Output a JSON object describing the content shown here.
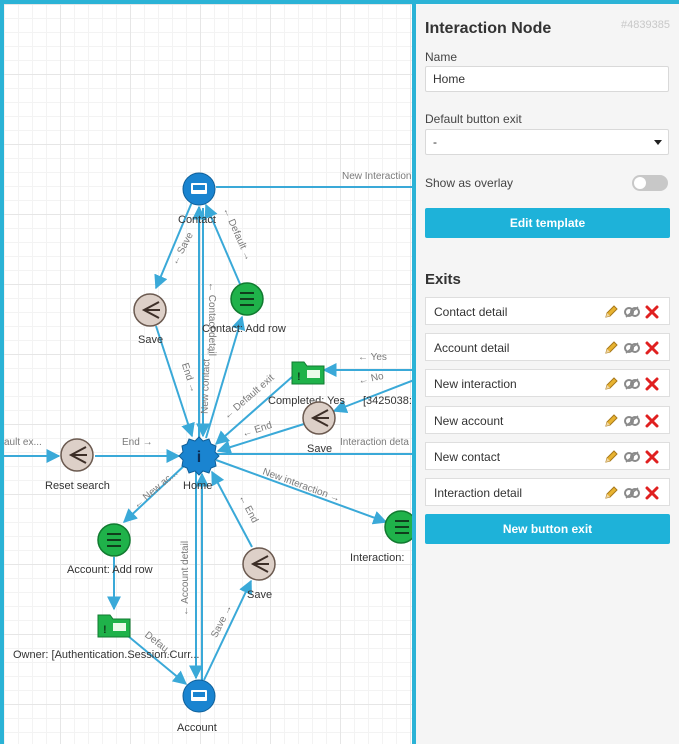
{
  "canvas": {
    "nodes": {
      "contact": "Contact",
      "save1": "Save",
      "contact_add_row": "Contact: Add row",
      "completed": "Completed: Yes",
      "id_partial": "[3425038:",
      "save2": "Save",
      "reset_search": "Reset search",
      "home": "Home",
      "interaction": "Interaction:",
      "account_add_row": "Account: Add row",
      "owner": "Owner: [Authentication.Session.Curr...",
      "save3": "Save",
      "account": "Account"
    },
    "edges": {
      "new_interaction_top": "New Interaction",
      "save": "← Save",
      "default_top": "← Default →",
      "contact_detail": "← Contact detail",
      "new_contact": "New contact →",
      "end_save1": "End →",
      "default_exit": "← Default exit",
      "yes": "← Yes",
      "no": "← No",
      "end_save2": "← End",
      "interaction_detail": "Interaction deta",
      "default_exit_left": "ault ex...",
      "end_reset": "End →",
      "new_account": "← New ac...",
      "new_interaction": "New interaction →",
      "account_detail": "← Account detail",
      "end_save3": "← End",
      "save_up": "Save →",
      "default_owner": "Defau..."
    },
    "icon_glyphs": {
      "info": "i",
      "rows": "≡",
      "branch": "⊲"
    }
  },
  "panel": {
    "title": "Interaction Node",
    "id": "#4839385",
    "name_label": "Name",
    "name_value": "Home",
    "default_exit_label": "Default button exit",
    "default_exit_value": "-",
    "overlay_label": "Show as overlay",
    "overlay_on": false,
    "edit_template": "Edit template",
    "exits_title": "Exits",
    "exits": [
      {
        "label": "Contact detail"
      },
      {
        "label": "Account detail"
      },
      {
        "label": "New interaction"
      },
      {
        "label": "New account"
      },
      {
        "label": "New contact"
      },
      {
        "label": "Interaction detail"
      }
    ],
    "new_exit": "New button exit"
  },
  "colors": {
    "accent": "#1eb2d9",
    "edge": "#3aa9d8",
    "node_blue": "#1a84d0",
    "node_green": "#1fb24a",
    "node_brown": "#ddd0c8",
    "delete_red": "#e02020",
    "edit_yellow": "#e8b330"
  }
}
